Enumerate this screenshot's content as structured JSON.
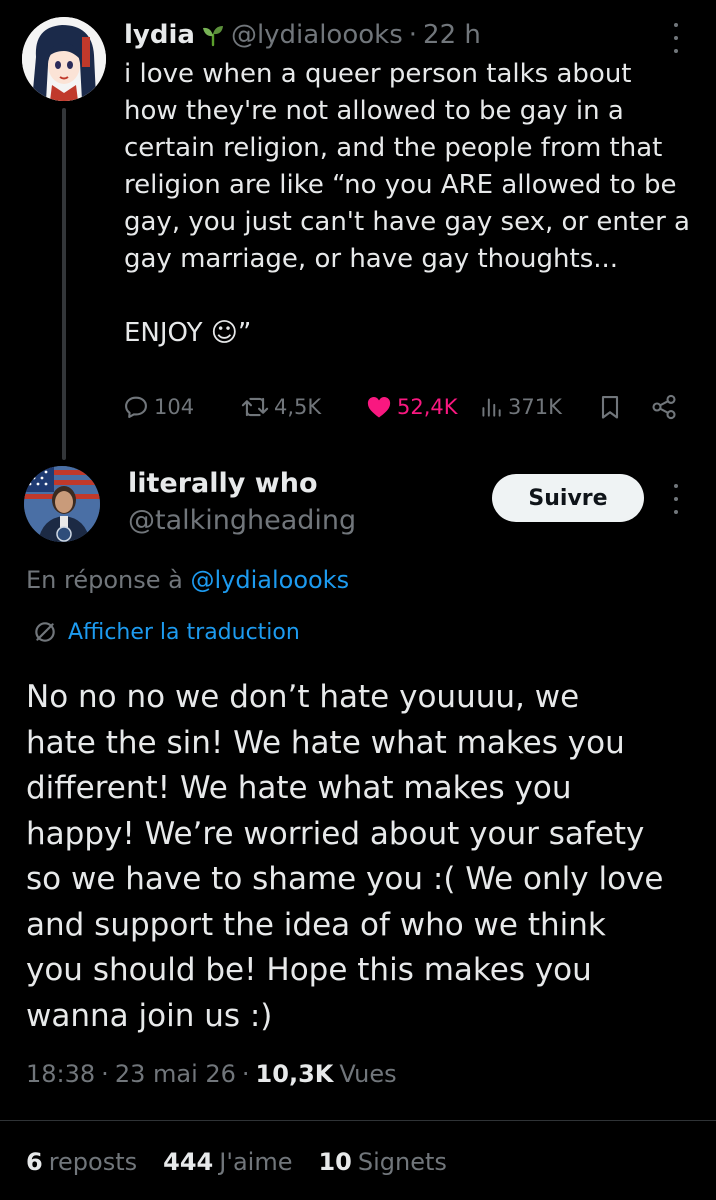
{
  "parent_tweet": {
    "author_name": "lydia",
    "author_emoji": "sprout-icon",
    "handle": "@lydialoooks",
    "separator": "·",
    "time_ago": "22 h",
    "text_part1": "i love when a queer person talks about\nhow they're not allowed to be gay in a\ncertain religion, and the people from that\nreligion are like “no you ARE allowed to be\ngay, you just can't have gay sex, or enter a\ngay marriage, or have gay thoughts...",
    "text_part2": "ENJOY ☺”",
    "stats": {
      "replies": "104",
      "reposts": "4,5K",
      "likes": "52,4K",
      "views": "371K"
    }
  },
  "main_tweet": {
    "author_name": "literally who",
    "handle": "@talkingheading",
    "follow_label": "Suivre",
    "reply_prefix": "En réponse à",
    "reply_mention": "@lydialoooks",
    "translate_label": "Afficher la traduction",
    "text": "No no no we don’t hate youuuu, we\nhate the sin! We hate what makes you\ndifferent! We hate what makes you\nhappy! We’re worried about your safety\nso we have to shame you :( We only love\nand support the idea of who we think\nyou should be! Hope this makes you\nwanna join us :)",
    "time": "18:38",
    "sep": "·",
    "date": "23 mai 26",
    "views_count": "10,3K",
    "views_label": "Vues",
    "reposts_count": "6",
    "reposts_label": "reposts",
    "likes_count": "444",
    "likes_label": "J'aime",
    "bookmarks_count": "10",
    "bookmarks_label": "Signets"
  },
  "colors": {
    "background": "#000000",
    "text": "#e7e9ea",
    "muted": "#71767b",
    "link": "#1d9bf0",
    "like": "#f91880",
    "button_bg": "#eff3f4"
  }
}
